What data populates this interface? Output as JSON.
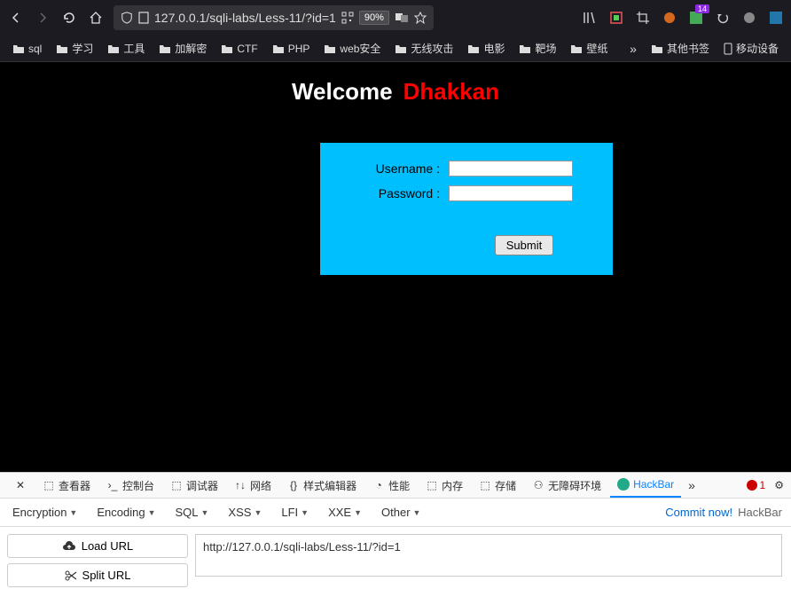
{
  "browser": {
    "url": "127.0.0.1/sqli-labs/Less-11/?id=1",
    "zoom": "90%"
  },
  "bookmarks": {
    "items": [
      "sql",
      "学习",
      "工具",
      "加解密",
      "CTF",
      "PHP",
      "web安全",
      "无线攻击",
      "电影",
      "靶场",
      "壁纸"
    ],
    "other": "其他书签",
    "mobile": "移动设备"
  },
  "page": {
    "welcome": "Welcome",
    "name": "Dhakkan",
    "username_label": "Username :",
    "password_label": "Password :",
    "submit": "Submit"
  },
  "devtools": {
    "tabs": [
      "查看器",
      "控制台",
      "调试器",
      "网络",
      "样式编辑器",
      "性能",
      "内存",
      "存储",
      "无障碍环境"
    ],
    "hackbar": "HackBar",
    "errors": "1"
  },
  "hackbar": {
    "menu": [
      "Encryption",
      "Encoding",
      "SQL",
      "XSS",
      "LFI",
      "XXE",
      "Other"
    ],
    "commit": "Commit now!",
    "brand": "HackBar",
    "load_url": "Load URL",
    "split_url": "Split URL",
    "url_value": "http://127.0.0.1/sqli-labs/Less-11/?id=1"
  }
}
